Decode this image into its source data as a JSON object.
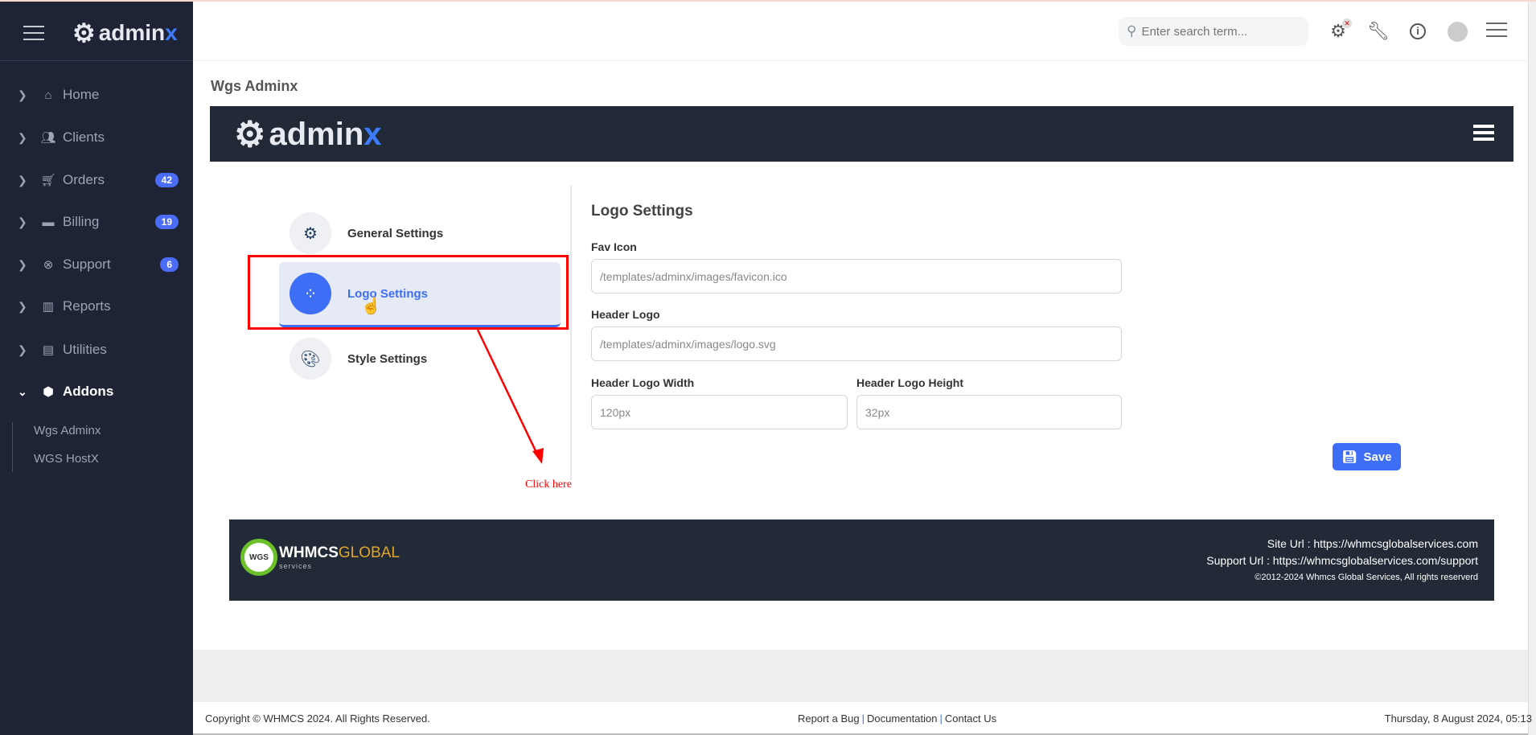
{
  "brand": {
    "name_prefix": "admin",
    "name_suffix": "x"
  },
  "sidebar": {
    "items": [
      {
        "label": "Home",
        "icon": "home-icon"
      },
      {
        "label": "Clients",
        "icon": "users-icon"
      },
      {
        "label": "Orders",
        "icon": "cart-icon",
        "badge": "42"
      },
      {
        "label": "Billing",
        "icon": "credit-card-icon",
        "badge": "19"
      },
      {
        "label": "Support",
        "icon": "lifebuoy-icon",
        "badge": "6"
      },
      {
        "label": "Reports",
        "icon": "chart-icon"
      },
      {
        "label": "Utilities",
        "icon": "file-icon"
      },
      {
        "label": "Addons",
        "icon": "cube-icon"
      }
    ],
    "subitems": [
      "Wgs Adminx",
      "WGS HostX"
    ]
  },
  "topbar": {
    "search_placeholder": "Enter search term..."
  },
  "page": {
    "title": "Wgs Adminx"
  },
  "tabs": [
    "General Settings",
    "Logo Settings",
    "Style Settings"
  ],
  "annotation": {
    "text": "Click here",
    "color": "#ff0000"
  },
  "form": {
    "title": "Logo Settings",
    "fav_icon_label": "Fav Icon",
    "fav_icon_value": "/templates/adminx/images/favicon.ico",
    "header_logo_label": "Header Logo",
    "header_logo_value": "/templates/adminx/images/logo.svg",
    "width_label": "Header Logo Width",
    "width_value": "120px",
    "height_label": "Header Logo Height",
    "height_value": "32px",
    "save_label": "Save"
  },
  "footer_card": {
    "logo_main": "WHMCS",
    "logo_accent": "GLOBAL",
    "logo_sub": "services",
    "logo_badge": "WGS",
    "site_url": "Site Url : https://whmcsglobalservices.com",
    "support_url": "Support Url : https://whmcsglobalservices.com/support",
    "copyright": "©2012-2024 Whmcs Global Services, All rights reserverd"
  },
  "bottom": {
    "copyright": "Copyright © WHMCS 2024. All Rights Reserved.",
    "links": [
      "Report a Bug",
      "Documentation",
      "Contact Us"
    ],
    "datetime": "Thursday, 8 August 2024, 05:13"
  },
  "colors": {
    "accent": "#3d6ef5",
    "sidebar": "#1f2336",
    "banner": "#212a36"
  }
}
